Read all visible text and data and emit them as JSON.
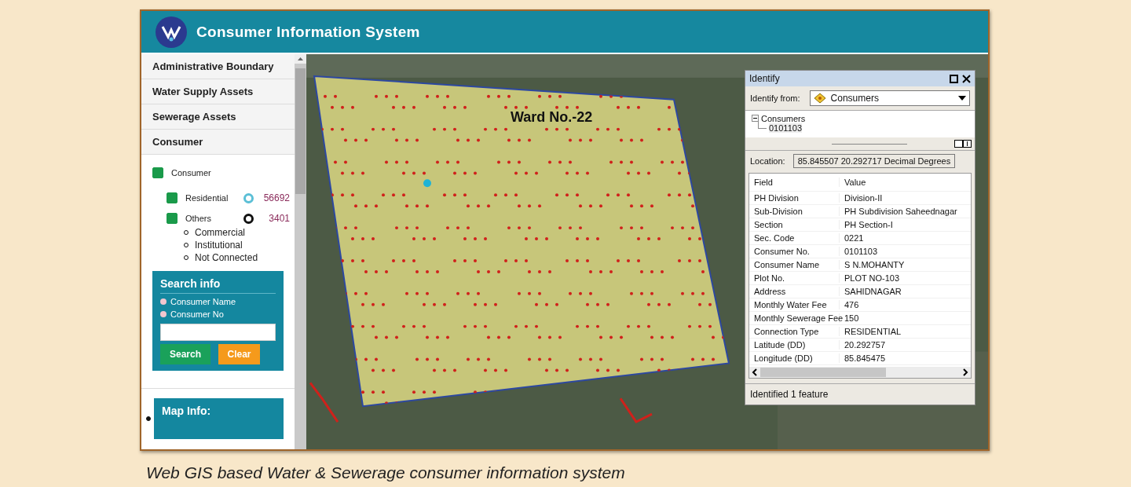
{
  "header": {
    "title": "Consumer Information System"
  },
  "sidebar": {
    "items": [
      {
        "label": "Administrative Boundary"
      },
      {
        "label": "Water Supply Assets"
      },
      {
        "label": "Sewerage Assets"
      },
      {
        "label": "Consumer"
      }
    ],
    "layers": {
      "label": "Consumer",
      "checked": true,
      "children": [
        {
          "label": "Residential",
          "checked": true,
          "count": "56692",
          "color": "#5bbfd6"
        },
        {
          "label": "Others",
          "checked": true,
          "count": "3401",
          "color": "#111111",
          "subtypes": [
            "Commercial",
            "Institutional",
            "Not Connected"
          ]
        }
      ]
    },
    "search": {
      "title": "Search info",
      "options": [
        {
          "label": "Consumer Name",
          "selected": false
        },
        {
          "label": "Consumer No",
          "selected": false
        }
      ],
      "buttons": [
        "Search",
        "Clear"
      ]
    },
    "map_info": {
      "title": "Map Info:"
    }
  },
  "map": {
    "label": "Ward No.-22"
  },
  "identify": {
    "title": "Identify",
    "from_label": "Identify from:",
    "from_value": "Consumers",
    "tree": {
      "label": "Consumers",
      "expanded": true,
      "children": [
        {
          "label": "0101103"
        }
      ]
    },
    "location_label": "Location:",
    "location": "85.845507  20.292717 Decimal Degrees",
    "columns": [
      "Field",
      "Value"
    ],
    "rows": [
      [
        "PH Division",
        "Division-II"
      ],
      [
        "Sub-Division",
        "PH Subdivision Saheednagar"
      ],
      [
        "Section",
        "PH Section-I"
      ],
      [
        "Sec. Code",
        "0221"
      ],
      [
        "Consumer No.",
        "0101103"
      ],
      [
        "Consumer Name",
        "S  N.MOHANTY"
      ],
      [
        "Plot No.",
        "PLOT NO-103"
      ],
      [
        "Address",
        "SAHIDNAGAR"
      ],
      [
        "Monthly Water Fee",
        "476"
      ],
      [
        "Monthly Sewerage Fee",
        "150"
      ],
      [
        "Connection Type",
        "RESIDENTIAL"
      ],
      [
        "Latitude (DD)",
        "20.292757"
      ],
      [
        "Longitude (DD)",
        "85.845475"
      ]
    ],
    "status": "Identified 1 feature"
  },
  "caption": "Web GIS based Water & Sewerage consumer information system"
}
